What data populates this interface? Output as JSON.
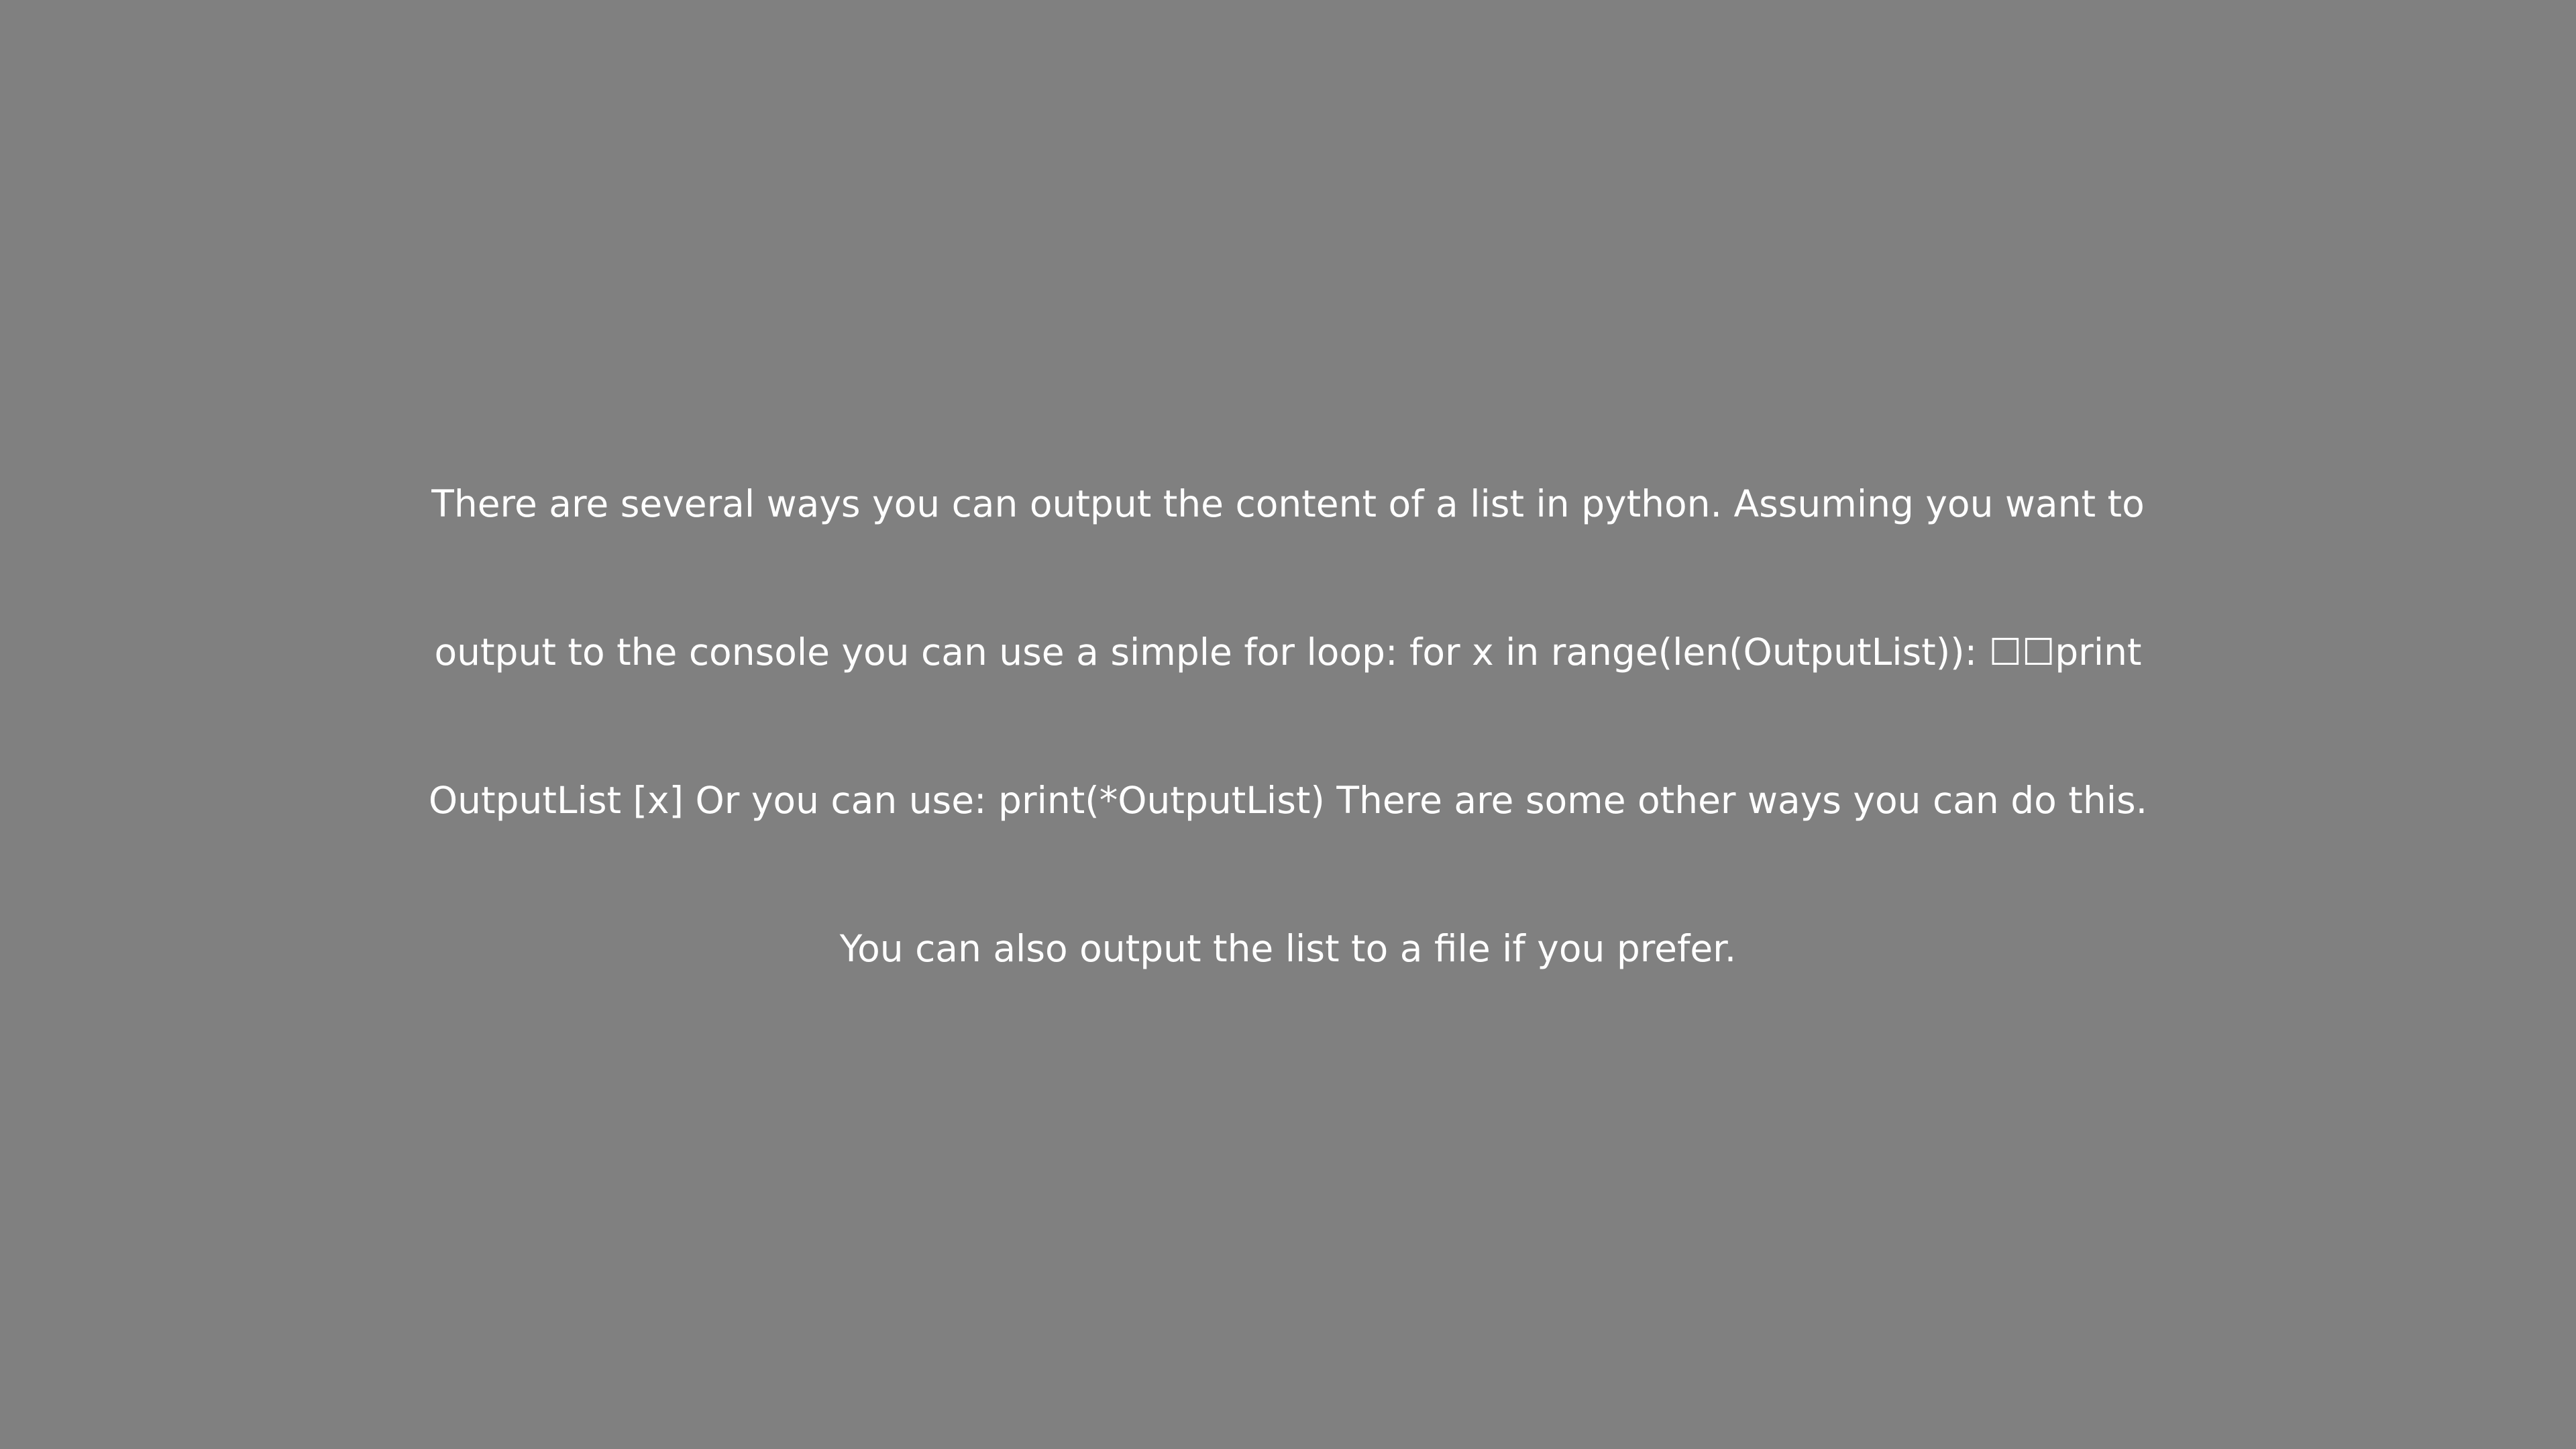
{
  "theme": {
    "background": "#808080",
    "text_color": "#ffffff"
  },
  "message": {
    "lines": [
      "There are several ways you can output the content of a list in python. Assuming you want to",
      "output to the console you can use a simple for loop: for x in range(len(OutputList)): ☐☐print",
      "OutputList [x] Or you can use: print(*OutputList) There are some other ways you can do this.",
      "You can also output the list to a file if you prefer."
    ]
  }
}
